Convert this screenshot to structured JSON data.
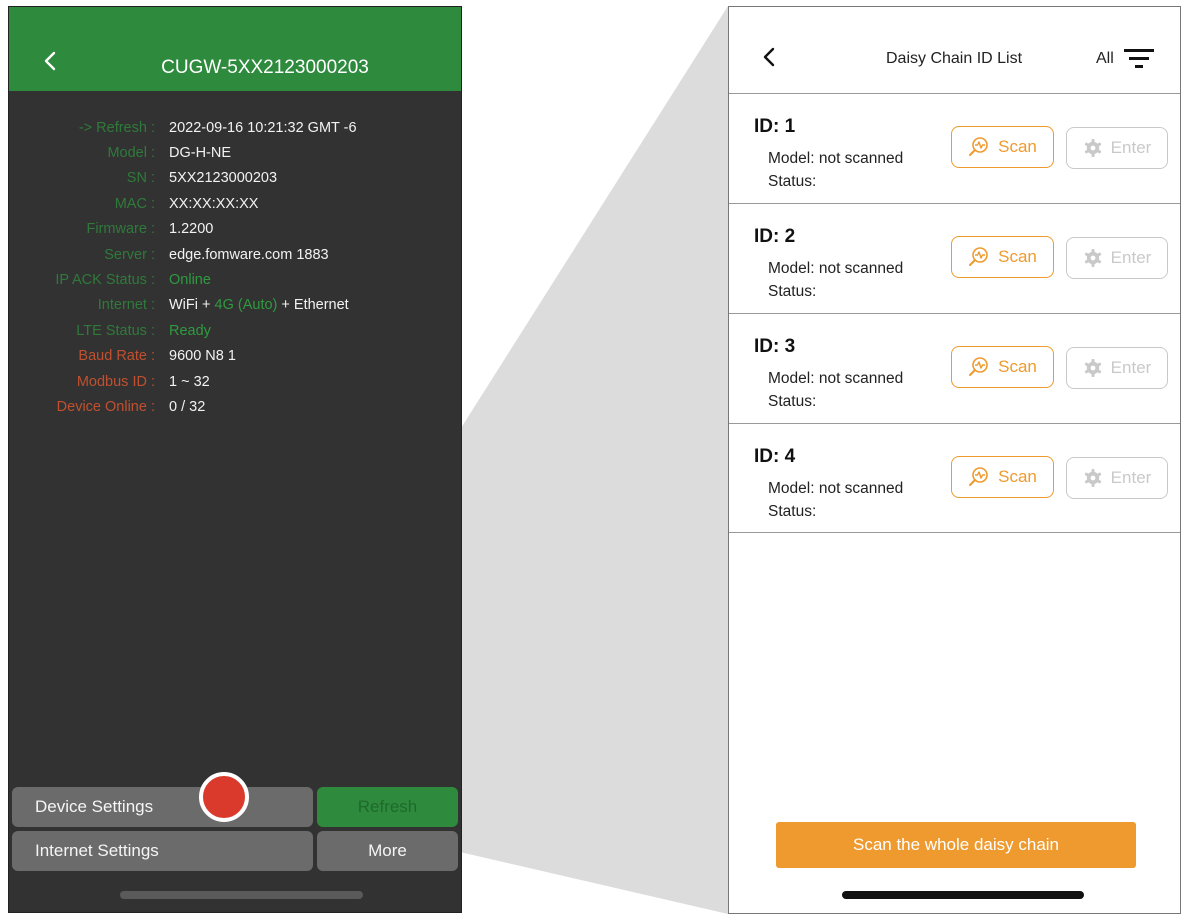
{
  "left": {
    "title": "CUGW-5XX2123000203",
    "info": [
      {
        "label": "-> Refresh :",
        "value": "2022-09-16 10:21:32 GMT -6",
        "label_color": "green"
      },
      {
        "label": "Model :",
        "value": "DG-H-NE",
        "label_color": "green"
      },
      {
        "label": "SN :",
        "value": "5XX2123000203",
        "label_color": "green"
      },
      {
        "label": "MAC :",
        "value": "XX:XX:XX:XX",
        "label_color": "green"
      },
      {
        "label": "Firmware :",
        "value": "1.2200",
        "label_color": "green"
      },
      {
        "label": "Server :",
        "value": "edge.fomware.com 1883",
        "label_color": "green"
      },
      {
        "label": "IP ACK Status :",
        "value": "Online",
        "label_color": "green",
        "value_color": "green"
      },
      {
        "label": "Internet :",
        "value_parts": [
          "WiFi + ",
          "4G (Auto)",
          " + Ethernet"
        ],
        "label_color": "green"
      },
      {
        "label": "LTE Status :",
        "value": "Ready",
        "label_color": "green",
        "value_color": "green"
      },
      {
        "label": "Baud Rate :",
        "value": "9600 N8 1",
        "label_color": "orange"
      },
      {
        "label": "Modbus ID :",
        "value": "1 ~ 32",
        "label_color": "orange"
      },
      {
        "label": "Device Online :",
        "value": "0 / 32",
        "label_color": "orange"
      }
    ],
    "buttons": {
      "device_settings": "Device Settings",
      "refresh": "Refresh",
      "internet_settings": "Internet Settings",
      "more": "More"
    }
  },
  "right": {
    "title": "Daisy Chain ID List",
    "filter_label": "All",
    "items": [
      {
        "id": "ID: 1",
        "model": "Model: not scanned",
        "status": "Status:",
        "scan": "Scan",
        "enter": "Enter"
      },
      {
        "id": "ID: 2",
        "model": "Model: not scanned",
        "status": "Status:",
        "scan": "Scan",
        "enter": "Enter"
      },
      {
        "id": "ID: 3",
        "model": "Model: not scanned",
        "status": "Status:",
        "scan": "Scan",
        "enter": "Enter"
      },
      {
        "id": "ID: 4",
        "model": "Model: not scanned",
        "status": "Status:",
        "scan": "Scan",
        "enter": "Enter"
      }
    ],
    "scan_all": "Scan the whole daisy chain"
  },
  "colors": {
    "header_green": "#2e8b3e",
    "accent_orange": "#ef9a2f",
    "highlight_red": "#d93a2b"
  }
}
